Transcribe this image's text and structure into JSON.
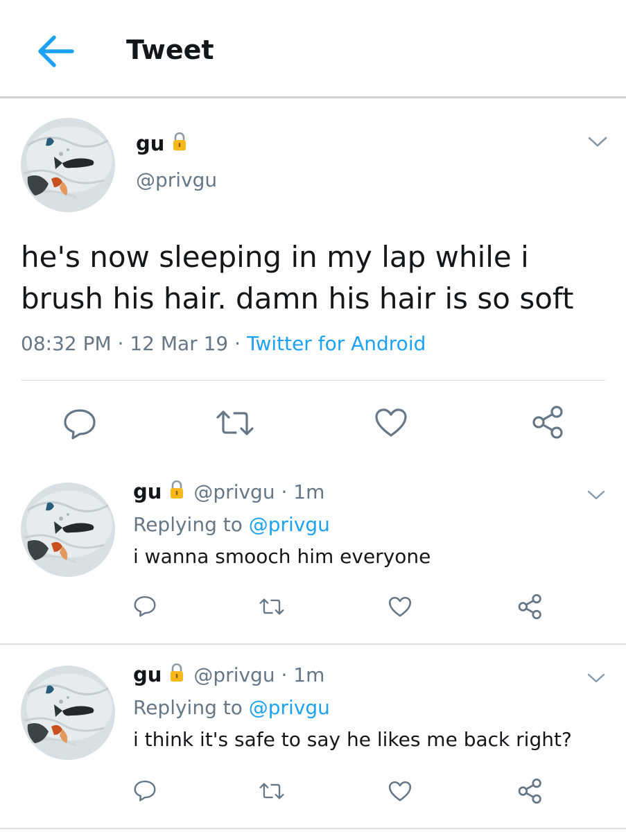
{
  "header": {
    "title": "Tweet"
  },
  "tweet": {
    "name": "gu",
    "handle": "@privgu",
    "text": "he's now sleeping in my lap while i brush his hair. damn his hair is so soft",
    "time": "08:32 PM",
    "date": "12 Mar 19",
    "source": "Twitter for Android",
    "sep": "·"
  },
  "replies": [
    {
      "name": "gu",
      "handle": "@privgu · 1m",
      "replying_prefix": "Replying to ",
      "replying_to": "@privgu",
      "text": "i wanna smooch him everyone"
    },
    {
      "name": "gu",
      "handle": "@privgu · 1m",
      "replying_prefix": "Replying to ",
      "replying_to": "@privgu",
      "text": "i think it's safe to say he likes me back right?"
    }
  ],
  "icons": {
    "back": "arrow-left-icon",
    "lock": "lock-icon",
    "chevron": "chevron-down-icon",
    "reply": "reply-icon",
    "retweet": "retweet-icon",
    "like": "heart-icon",
    "share": "share-icon"
  },
  "colors": {
    "accent": "#1da1f2",
    "secondary": "#657786",
    "icon": "#657786",
    "lock": "#f5b71a"
  }
}
